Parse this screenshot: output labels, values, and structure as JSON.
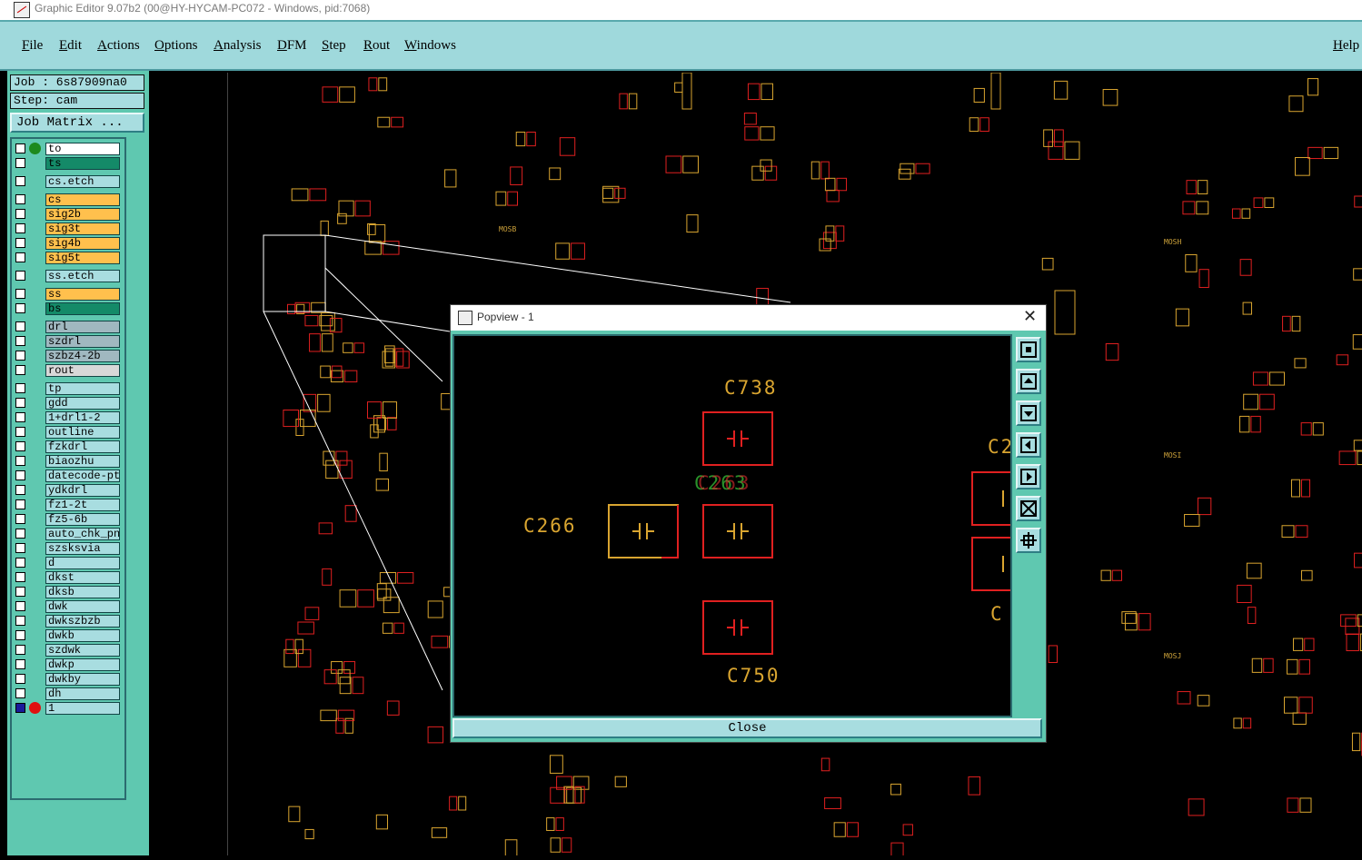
{
  "window": {
    "title": "Graphic Editor 9.07b2 (00@HY-HYCAM-PC072 - Windows, pid:7068)"
  },
  "menu": {
    "file": "File",
    "edit": "Edit",
    "actions": "Actions",
    "options": "Options",
    "analysis": "Analysis",
    "dfm": "DFM",
    "step": "Step",
    "rout": "Rout",
    "windows": "Windows",
    "help": "Help"
  },
  "job": {
    "job": "Job : 6s87909na0",
    "step": "Step: cam",
    "matrix": "Job Matrix ..."
  },
  "layers": [
    {
      "name": "to",
      "color": "#ffffff",
      "dot": "#1d8a1d"
    },
    {
      "name": "ts",
      "color": "#148a68"
    },
    {
      "name": "cs.etch",
      "color": "#a8dde0"
    },
    {
      "name": "cs",
      "color": "#ffc04d"
    },
    {
      "name": "sig2b",
      "color": "#ffc04d"
    },
    {
      "name": "sig3t",
      "color": "#ffc04d"
    },
    {
      "name": "sig4b",
      "color": "#ffc04d"
    },
    {
      "name": "sig5t",
      "color": "#ffc04d"
    },
    {
      "name": "ss.etch",
      "color": "#a8dde0"
    },
    {
      "name": "ss",
      "color": "#ffc04d"
    },
    {
      "name": "bs",
      "color": "#148a68"
    },
    {
      "name": "drl",
      "color": "#a0b8c0"
    },
    {
      "name": "szdrl",
      "color": "#a0b8c0"
    },
    {
      "name": "szbz4-2b",
      "color": "#a0b8c0"
    },
    {
      "name": "rout",
      "color": "#d8d8d8"
    },
    {
      "name": "tp",
      "color": "#a8dde0"
    },
    {
      "name": "gdd",
      "color": "#a8dde0"
    },
    {
      "name": "1+drl1-2",
      "color": "#a8dde0"
    },
    {
      "name": "outline",
      "color": "#a8dde0"
    },
    {
      "name": "fzkdrl",
      "color": "#a8dde0"
    },
    {
      "name": "biaozhu",
      "color": "#a8dde0"
    },
    {
      "name": "datecode-pte",
      "color": "#a8dde0"
    },
    {
      "name": "ydkdrl",
      "color": "#a8dde0"
    },
    {
      "name": "fz1-2t",
      "color": "#a8dde0"
    },
    {
      "name": "fz5-6b",
      "color": "#a8dde0"
    },
    {
      "name": "auto_chk_pnl",
      "color": "#a8dde0"
    },
    {
      "name": "szsksvia",
      "color": "#a8dde0"
    },
    {
      "name": "d",
      "color": "#a8dde0"
    },
    {
      "name": "dkst",
      "color": "#a8dde0"
    },
    {
      "name": "dksb",
      "color": "#a8dde0"
    },
    {
      "name": "dwk",
      "color": "#a8dde0"
    },
    {
      "name": "dwkszbzb",
      "color": "#a8dde0"
    },
    {
      "name": "dwkb",
      "color": "#a8dde0"
    },
    {
      "name": "szdwk",
      "color": "#a8dde0"
    },
    {
      "name": "dwkp",
      "color": "#a8dde0"
    },
    {
      "name": "dwkby",
      "color": "#a8dde0"
    },
    {
      "name": "dh",
      "color": "#a8dde0"
    },
    {
      "name": "1",
      "color": "#a8dde0",
      "dot": "#e01010"
    }
  ],
  "canvas_labels": {
    "mosb": "MOSB",
    "mosh": "MOSH",
    "mosi": "MOSI",
    "mosj": "MOSJ"
  },
  "popview": {
    "title": "Popview - 1",
    "labels": {
      "c738": "C738",
      "c263": "C263",
      "c266": "C266",
      "c750": "C750",
      "c_right1": "C2",
      "c_right2": "C"
    },
    "close": "Close"
  },
  "colors": {
    "accent": "#9fd9dc",
    "panel": "#5fc8b0",
    "pad_red": "#e02020",
    "silk_yellow": "#d9a530"
  }
}
